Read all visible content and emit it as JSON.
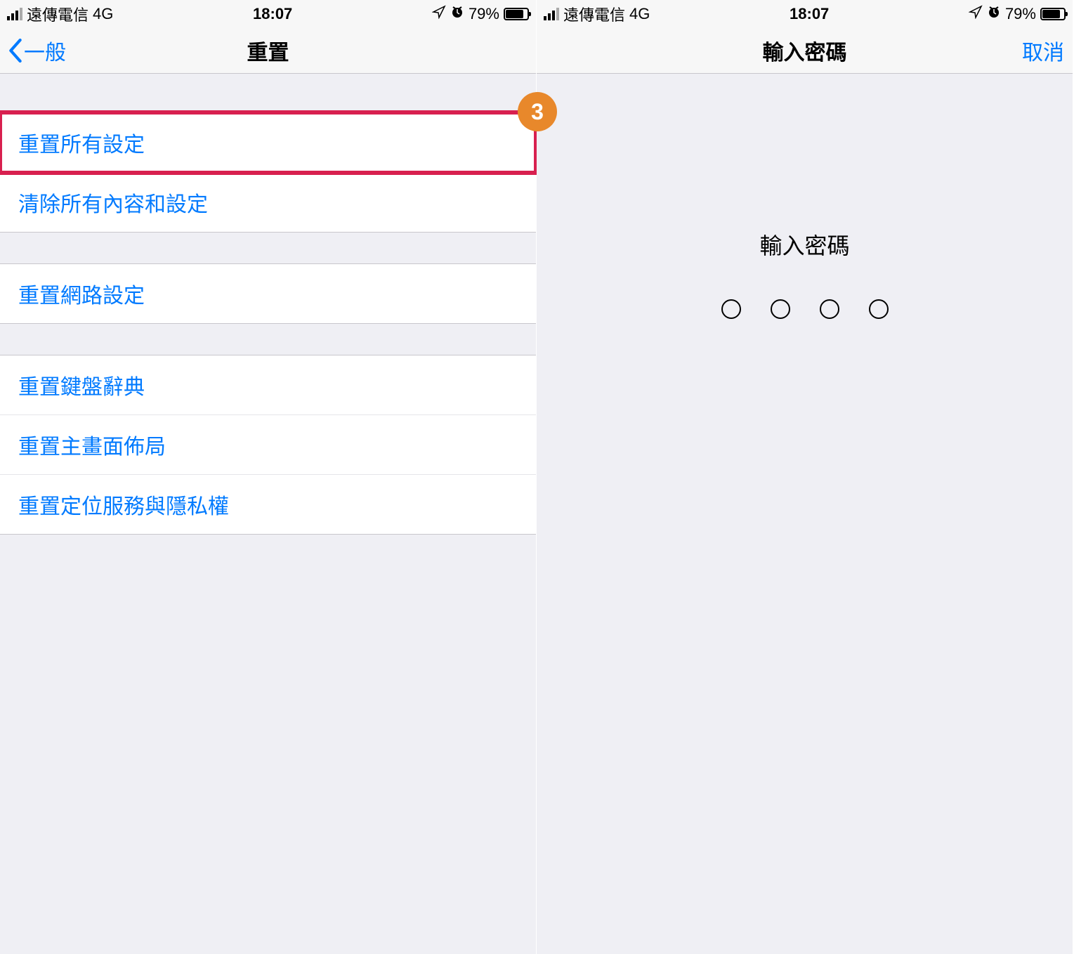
{
  "status": {
    "carrier": "遠傳電信",
    "network": "4G",
    "time": "18:07",
    "battery_pct": "79%"
  },
  "left": {
    "back_label": "一般",
    "title": "重置",
    "sections": [
      {
        "rows": [
          "重置所有設定",
          "清除所有內容和設定"
        ]
      },
      {
        "rows": [
          "重置網路設定"
        ]
      },
      {
        "rows": [
          "重置鍵盤辭典",
          "重置主畫面佈局",
          "重置定位服務與隱私權"
        ]
      }
    ],
    "badge": "3"
  },
  "right": {
    "title": "輸入密碼",
    "cancel": "取消",
    "prompt": "輸入密碼"
  }
}
